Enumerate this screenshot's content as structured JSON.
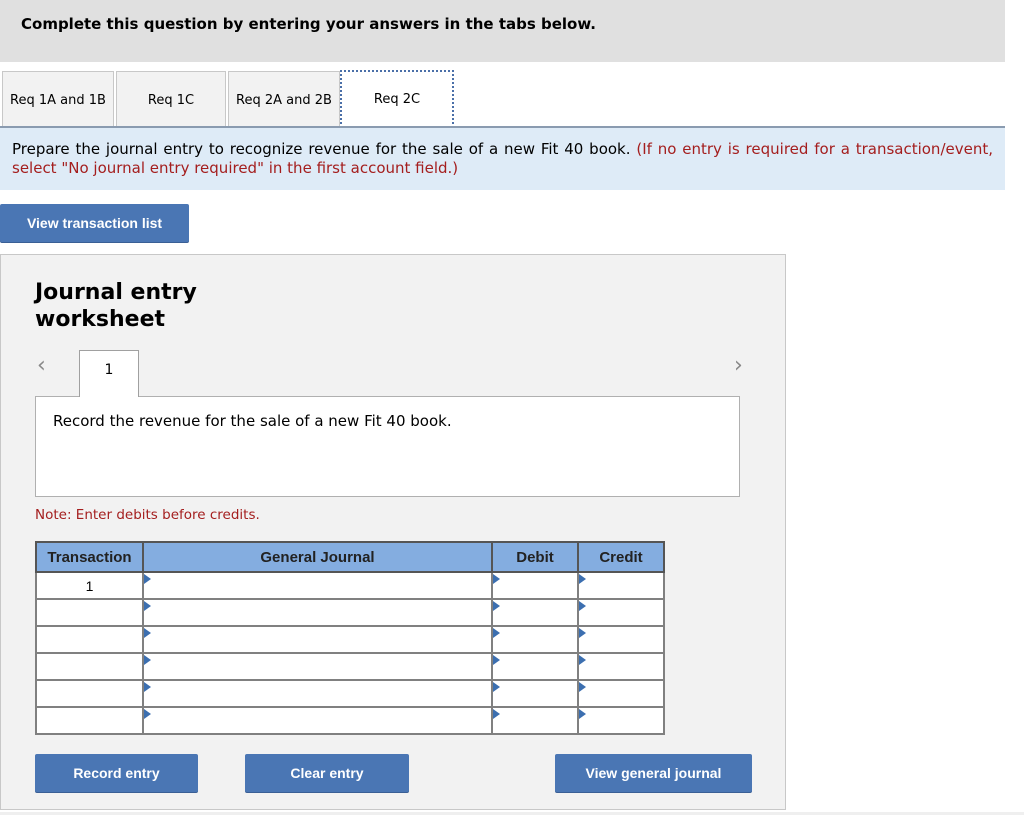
{
  "header": {
    "title": "Complete this question by entering your answers in the tabs below."
  },
  "tabs": [
    {
      "label": "Req 1A and 1B",
      "active": false
    },
    {
      "label": "Req 1C",
      "active": false
    },
    {
      "label": "Req 2A and 2B",
      "active": false
    },
    {
      "label": "Req 2C",
      "active": true
    }
  ],
  "instructions": {
    "text": "Prepare the journal entry to recognize revenue for the sale of a new Fit 40 book.",
    "hint": "(If no entry is required for a transaction/event, select \"No journal entry required\" in the first account field.)"
  },
  "view_transaction_list_label": "View transaction list",
  "worksheet": {
    "title": "Journal entry worksheet",
    "prev_icon": "chevron-left-icon",
    "next_icon": "chevron-right-icon",
    "entry_tab": "1",
    "description": "Record the revenue for the sale of a new Fit 40 book.",
    "note": "Note: Enter debits before credits.",
    "table": {
      "headers": [
        "Transaction",
        "General Journal",
        "Debit",
        "Credit"
      ],
      "rows": [
        {
          "transaction": "1",
          "account": "",
          "debit": "",
          "credit": ""
        },
        {
          "transaction": "",
          "account": "",
          "debit": "",
          "credit": ""
        },
        {
          "transaction": "",
          "account": "",
          "debit": "",
          "credit": ""
        },
        {
          "transaction": "",
          "account": "",
          "debit": "",
          "credit": ""
        },
        {
          "transaction": "",
          "account": "",
          "debit": "",
          "credit": ""
        },
        {
          "transaction": "",
          "account": "",
          "debit": "",
          "credit": ""
        }
      ]
    },
    "buttons": {
      "record": "Record entry",
      "clear": "Clear entry",
      "view_journal": "View general journal"
    }
  }
}
